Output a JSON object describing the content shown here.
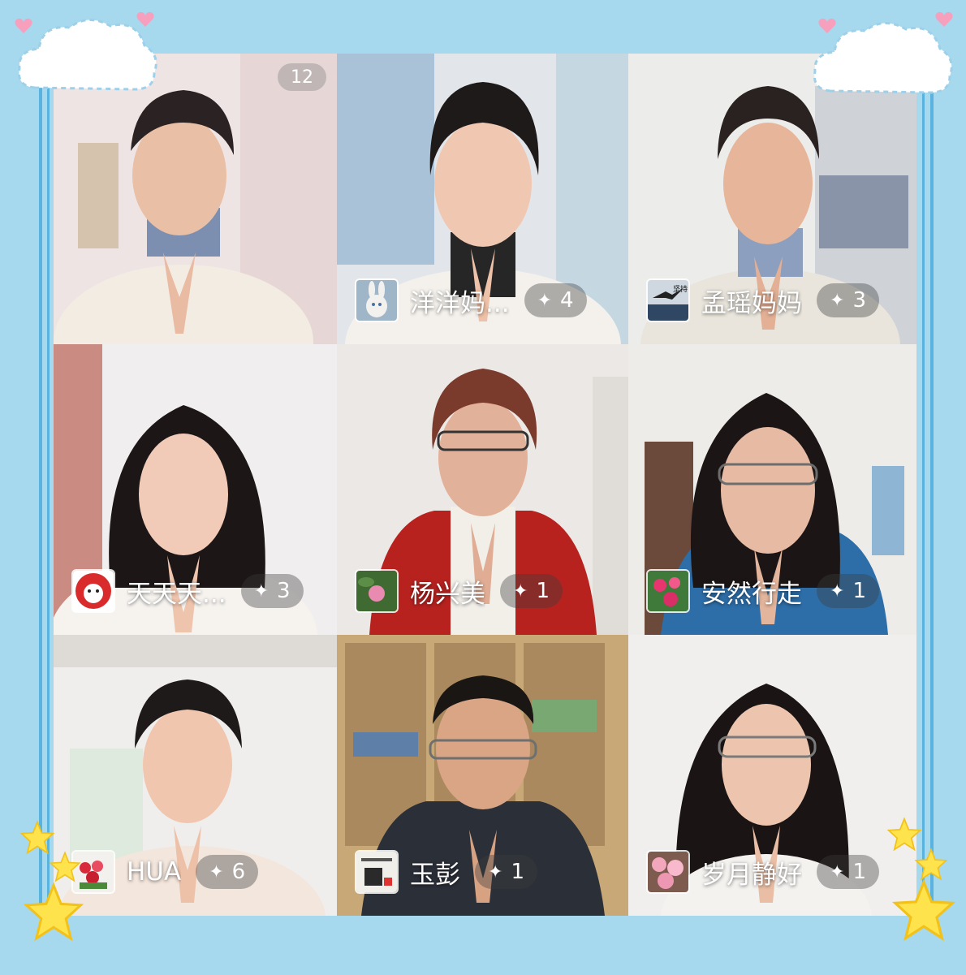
{
  "participant_count": "12",
  "tiles": [
    {
      "name": "",
      "stars": ""
    },
    {
      "name": "洋洋妈...",
      "stars": "4"
    },
    {
      "name": "孟瑶妈妈",
      "stars": "3"
    },
    {
      "name": "天天天...",
      "stars": "3"
    },
    {
      "name": "杨兴美",
      "stars": "1"
    },
    {
      "name": "安然行走",
      "stars": "1"
    },
    {
      "name": "HUA",
      "stars": "6"
    },
    {
      "name": "玉彭",
      "stars": "1"
    },
    {
      "name": "岁月静好",
      "stars": "1"
    }
  ],
  "avatar_text": "坚持",
  "colors": {
    "background": "#a6d8ee",
    "border_line": "#5ab3de",
    "star": "#ffe34d",
    "heart": "#f7a0bd"
  }
}
